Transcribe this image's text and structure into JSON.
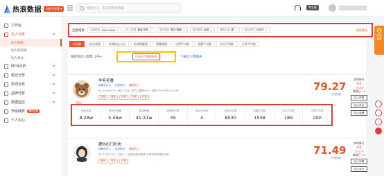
{
  "header": {
    "logo_text": "热浪数据",
    "version_badge": "分析专业版 ▾",
    "search_placeholder": "搜索达人、笔记或其他数据",
    "pro_badge": "专业版"
  },
  "sidebar": {
    "items": [
      {
        "label": "工作台",
        "icon": "home-icon"
      },
      {
        "label": "达人分析",
        "icon": "user-analysis-icon",
        "active": true
      }
    ],
    "sub_items": [
      {
        "label": "达人搜索",
        "active": true
      },
      {
        "label": "达人排行榜"
      },
      {
        "label": "达人对比"
      }
    ],
    "more_items": [
      {
        "label": "MCN分析",
        "icon": "mcn-icon"
      },
      {
        "label": "笔记分析",
        "icon": "note-icon"
      },
      {
        "label": "热词分析",
        "icon": "hotword-icon"
      },
      {
        "label": "品牌分析",
        "icon": "brand-icon"
      },
      {
        "label": "数据监控",
        "icon": "monitor-icon"
      },
      {
        "label": "升级续费",
        "icon": "upgrade-icon",
        "tag": "限时优惠"
      },
      {
        "label": "个人中心",
        "icon": "profile-icon"
      }
    ]
  },
  "filters": {
    "label": "全部结果",
    "chips": [
      {
        "k": "全部粉丝",
        "v": "1000-9999"
      },
      {
        "k": "达人类型",
        "v": "美妆·护肤"
      },
      {
        "k": "笔记类型",
        "v": "图文·视频"
      },
      {
        "k": "笔记类别",
        "v": "全部"
      },
      {
        "k": "是否认证",
        "v": "是"
      },
      {
        "k": "商业合作",
        "v": "已合作"
      }
    ],
    "clear_label": "清空筛选"
  },
  "tabs": [
    "粉丝数",
    "粉丝增量",
    "新增粉丝占比",
    "新增赞藏量",
    "赞藏增量",
    "点赞平均数",
    "收藏平均数",
    "评论平均数",
    "分享平均数"
  ],
  "results": {
    "prefix": "搜索到达人数量:",
    "count": "2千+",
    "generate_label": "生成达人数据报告",
    "download_label": "下载达人数据表"
  },
  "kol1": {
    "name": "羊毛毛番",
    "tags": [
      "品牌合作人",
      "优质笔记",
      "腰部达人"
    ],
    "id_line": "ID: yumao??? | 地区: 北京 | 签约: 星图MCN | 邮箱: ******@163.com",
    "labels": [
      "穿搭",
      "美妆",
      "好物",
      "护肤",
      "日常"
    ],
    "score": "79.27",
    "score_label": "热浪指数",
    "rank_label": "实时排行",
    "rank_value": "排名 33,000",
    "rank_sub": "较前日 +1",
    "live_tag": "KOL",
    "btn_report": "达人详情",
    "btn_compare": "加入对比",
    "btn_favorite": "加入收藏",
    "metrics": [
      {
        "l": "粉丝总量",
        "v": "8.28w"
      },
      {
        "l": "获赞与收藏",
        "v": "5.46w"
      },
      {
        "l": "新增赞藏",
        "v": "41.31w"
      },
      {
        "l": "新增笔记数",
        "v": "39"
      },
      {
        "l": "商业合作数",
        "v": "4"
      },
      {
        "l": "点赞平均数",
        "v": "8030"
      },
      {
        "l": "收藏平均数",
        "v": "1538"
      },
      {
        "l": "评论平均数",
        "v": "189"
      },
      {
        "l": "分享平均数",
        "v": "200"
      }
    ]
  },
  "kol2": {
    "name": "跟你出门吃肉",
    "tags": [
      "品牌合作人",
      "优质笔记",
      "腰部达人"
    ],
    "id_line": "ID: 5709?7457 | 简介: 一起探索城市美食 分享好吃好喝的日常",
    "labels": [
      "美食",
      "探店",
      "日常"
    ],
    "score": "71.49",
    "score_label": "热浪指数",
    "rank_label": "实时排行",
    "rank_value": "排名 44,778",
    "rank_sub": "较前日 +1",
    "btn_report": "达人详情",
    "btn_compare": "加入对比"
  },
  "float_bar": {
    "line1": "在线",
    "line2": "客服"
  }
}
